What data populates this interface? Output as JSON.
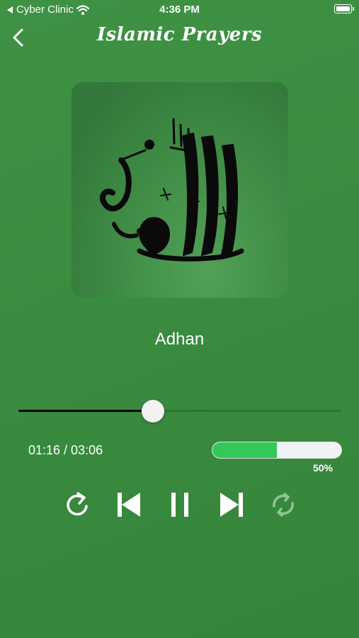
{
  "status_bar": {
    "carrier": "Cyber Clinic",
    "time": "4:36 PM"
  },
  "nav": {
    "title": "Islamic Prayers",
    "back_icon": "chevron-left-icon"
  },
  "track": {
    "title": "Adhan",
    "elapsed_display": "01:16 / 03:06",
    "progress": 0.41
  },
  "volume": {
    "level": 0.5,
    "label": "50%"
  },
  "controls": {
    "icons": [
      "repeat-icon",
      "skip-previous-icon",
      "pause-icon",
      "skip-next-icon",
      "shuffle-icon"
    ]
  },
  "colors": {
    "background": "#3a8c40",
    "volume_fill": "#34c759",
    "shuffle_inactive": "#8fc494",
    "slider_fill": "#000000"
  }
}
